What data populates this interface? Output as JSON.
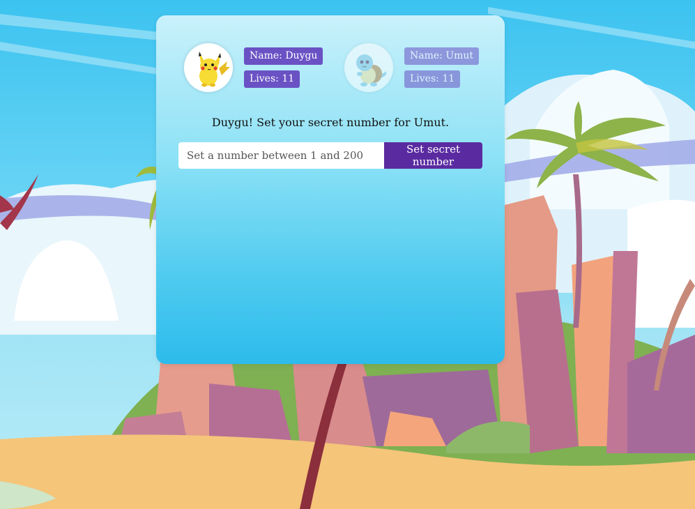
{
  "players": [
    {
      "name_label": "Name: Duygu",
      "lives_label": "Lives: 11",
      "avatar": "pikachu-avatar",
      "active": true
    },
    {
      "name_label": "Name: Umut",
      "lives_label": "Lives: 11",
      "avatar": "squirtle-avatar",
      "active": false
    }
  ],
  "prompt": "Duygu! Set your secret number for Umut.",
  "secret_form": {
    "placeholder": "Set a number between 1 and 200",
    "value": "",
    "button_label": "Set secret number"
  },
  "colors": {
    "badge": "#6a52c4",
    "button": "#5a2ba0",
    "card_top": "#c9f1fb",
    "card_bottom": "#2cbbec"
  }
}
